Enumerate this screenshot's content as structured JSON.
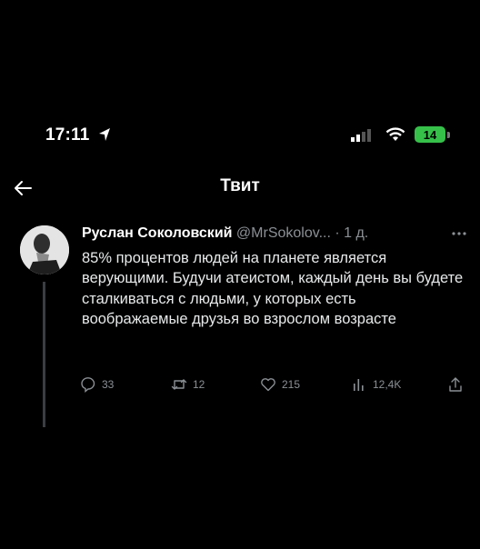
{
  "status_bar": {
    "time": "17:11",
    "battery_level": "14",
    "icons": [
      "location-arrow-icon",
      "cellular-signal-icon",
      "wifi-icon",
      "battery-icon"
    ]
  },
  "nav": {
    "title": "Твит",
    "back_icon": "arrow-left-icon"
  },
  "tweet": {
    "author_name": "Руслан Соколовский",
    "handle_time": " @MrSokolov... · 1 д.",
    "text": "85% процентов людей на планете является верующими. Будучи атеистом, каждый день вы будете сталкиваться с людьми, у которых есть воображаемые друзья во взрослом возрасте",
    "actions": {
      "replies": "33",
      "retweets": "12",
      "likes": "215",
      "views": "12,4K"
    }
  },
  "colors": {
    "background": "#000000",
    "text": "#e7e9ea",
    "secondary": "#8b9095",
    "battery": "#36c04a"
  }
}
